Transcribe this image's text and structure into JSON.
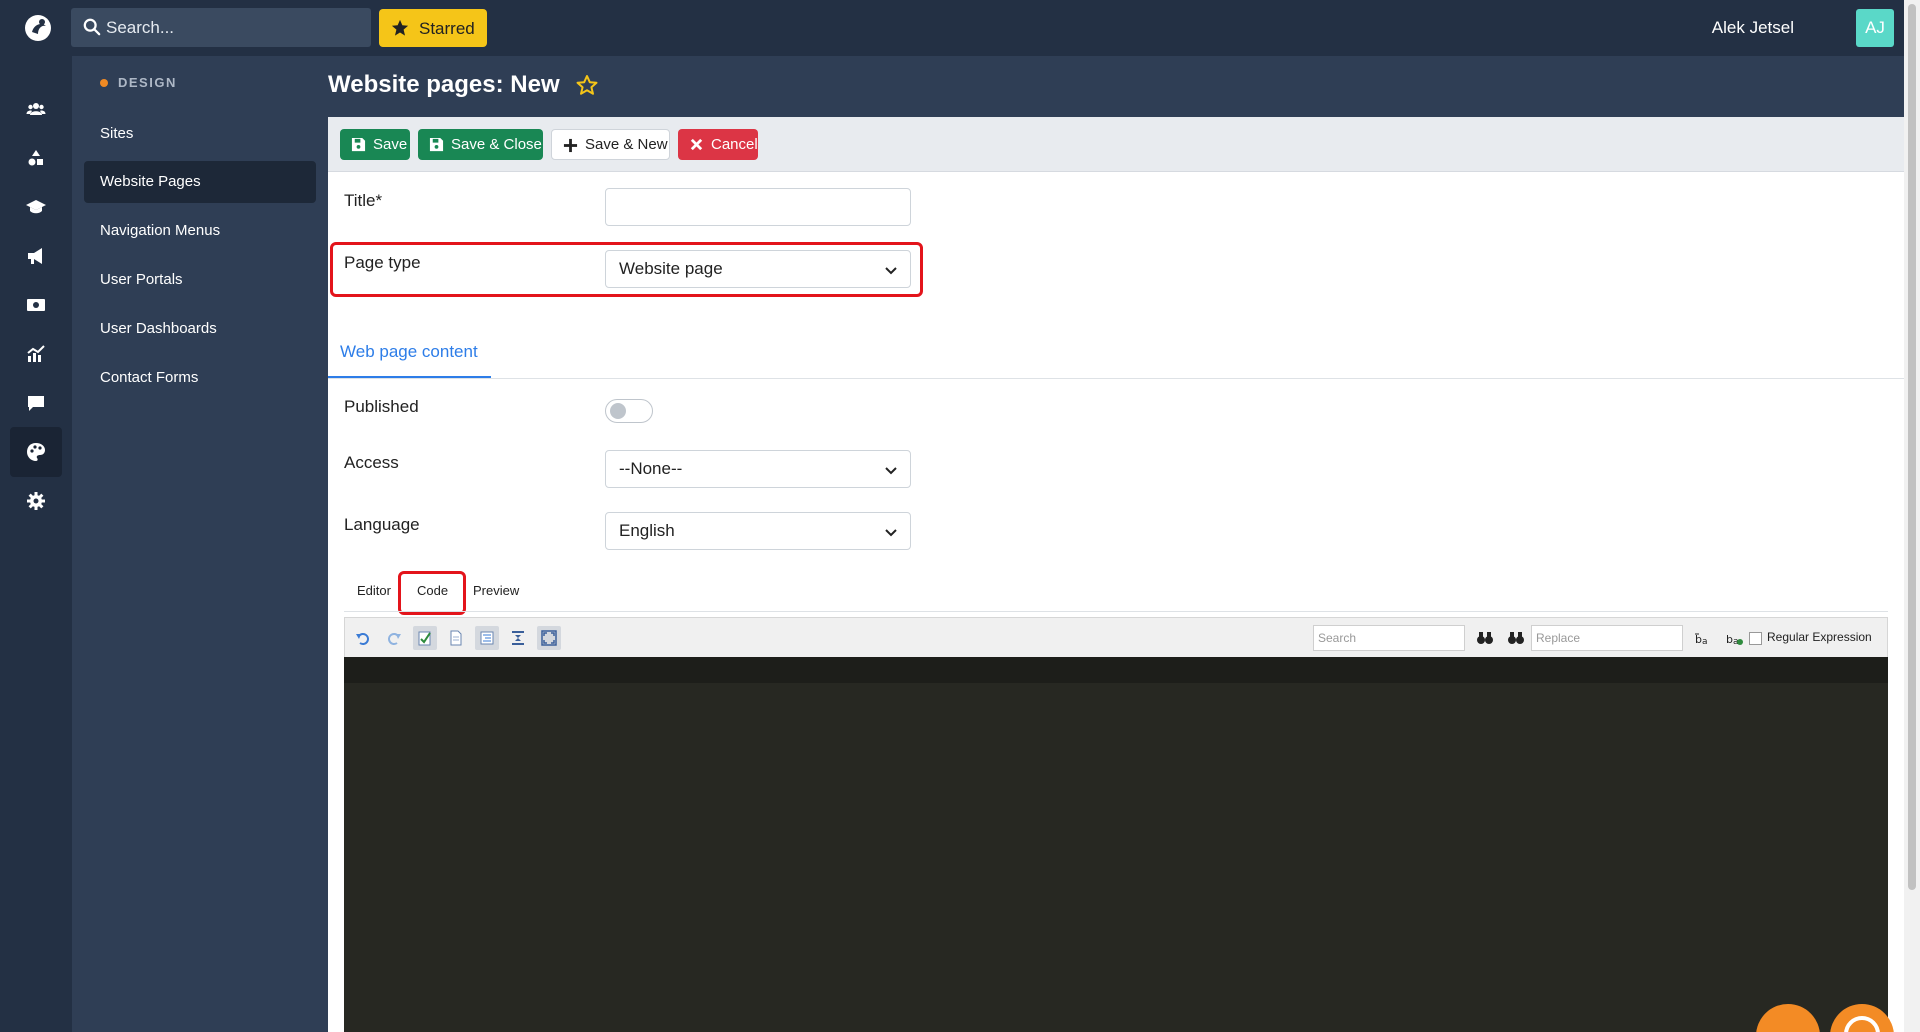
{
  "topbar": {
    "search_placeholder": "Search...",
    "starred_label": "Starred",
    "username": "Alek Jetsel",
    "avatar_initials": "AJ"
  },
  "rail": {
    "items": [
      "people-icon",
      "shapes-icon",
      "graduation-cap-icon",
      "megaphone-icon",
      "money-icon",
      "chart-icon",
      "chat-icon",
      "palette-icon",
      "gear-icon"
    ],
    "active": "palette-icon"
  },
  "nav": {
    "section": "DESIGN",
    "items": [
      {
        "label": "Sites"
      },
      {
        "label": "Website Pages"
      },
      {
        "label": "Navigation Menus"
      },
      {
        "label": "User Portals"
      },
      {
        "label": "User Dashboards"
      },
      {
        "label": "Contact Forms"
      }
    ],
    "active": "Website Pages"
  },
  "header": {
    "title": "Website pages: New"
  },
  "toolbar": {
    "save": "Save",
    "save_close": "Save & Close",
    "save_new": "Save & New",
    "cancel": "Cancel"
  },
  "form": {
    "title_label": "Title*",
    "title_value": "",
    "page_type_label": "Page type",
    "page_type_value": "Website page",
    "tab_label": "Web page content",
    "published_label": "Published",
    "published_on": false,
    "access_label": "Access",
    "access_value": "--None--",
    "language_label": "Language",
    "language_value": "English"
  },
  "editor": {
    "tabs": [
      "Editor",
      "Code",
      "Preview"
    ],
    "active_tab": "Code",
    "search_placeholder": "Search",
    "replace_placeholder": "Replace",
    "regex_label": "Regular Expression",
    "regex_checked": false
  },
  "colors": {
    "topbar": "#233044",
    "accent_blue": "#2d7de8",
    "highlight_red": "#e3141b",
    "save_green": "#198754",
    "cancel_red": "#dc3545",
    "starred_yellow": "#f5c518",
    "code_bg": "#272822"
  }
}
